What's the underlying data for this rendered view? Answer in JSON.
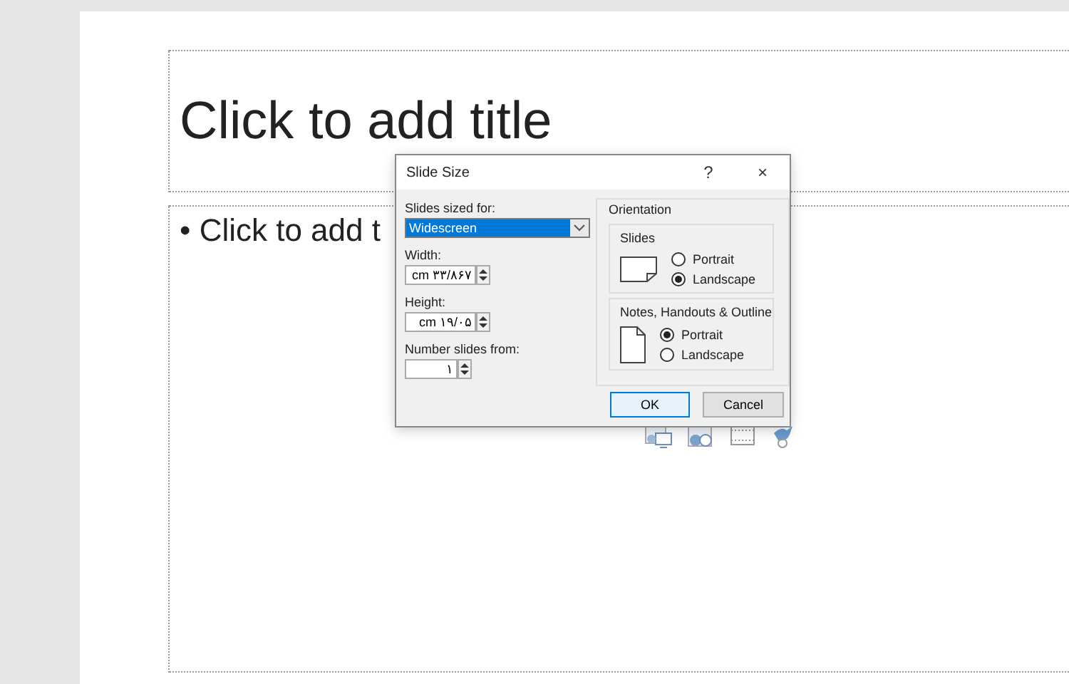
{
  "slide": {
    "title_placeholder": "Click to add title",
    "content_placeholder": "• Click to add t"
  },
  "dialog": {
    "title": "Slide Size",
    "help": "?",
    "close": "×",
    "sized_for": {
      "label": "Slides sized for:",
      "value": "Widescreen"
    },
    "width": {
      "label": "Width:",
      "value": "cm ۳۳/۸۶۷"
    },
    "height": {
      "label": "Height:",
      "value": "cm ۱۹/۰۵"
    },
    "number_from": {
      "label": "Number slides from:",
      "value": "۱"
    },
    "orientation": {
      "label": "Orientation",
      "groups": [
        {
          "label": "Slides",
          "kind": "landscape",
          "options": [
            {
              "label": "Portrait",
              "selected": false
            },
            {
              "label": "Landscape",
              "selected": true
            }
          ]
        },
        {
          "label": "Notes, Handouts & Outline",
          "kind": "portrait",
          "options": [
            {
              "label": "Portrait",
              "selected": true
            },
            {
              "label": "Landscape",
              "selected": false
            }
          ]
        }
      ]
    },
    "buttons": [
      {
        "label": "OK",
        "kind": "default"
      },
      {
        "label": "Cancel",
        "kind": "normal"
      }
    ]
  }
}
